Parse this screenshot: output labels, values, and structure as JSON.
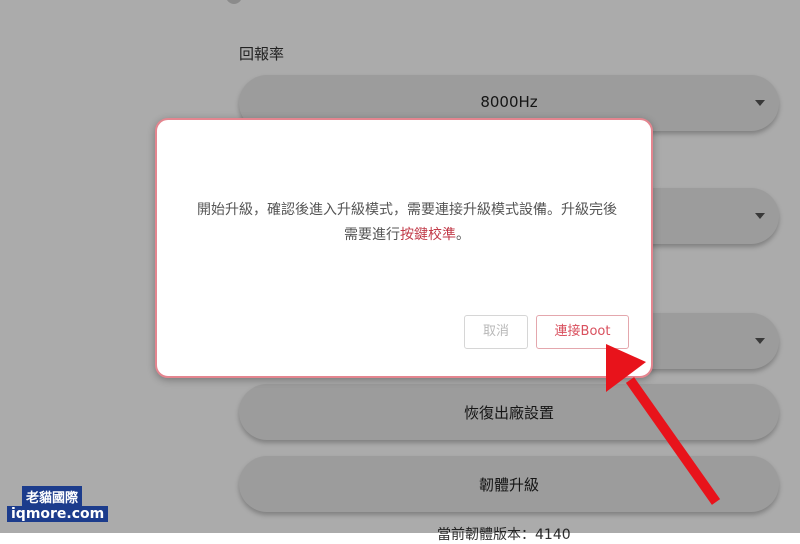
{
  "settings": {
    "report_rate_label": "回報率",
    "report_rate_value": "8000Hz",
    "restore_factory_label": "恢復出廠設置",
    "firmware_upgrade_label": "韌體升級",
    "firmware_version_text": "當前韌體版本：4140"
  },
  "dialog": {
    "message_part1": "開始升級，確認後進入升級模式，需要連接升級模式設備。升級完後需要進行",
    "message_highlight": "按鍵校準",
    "message_end": "。",
    "cancel_label": "取消",
    "connect_boot_label": "連接Boot"
  },
  "watermark": {
    "line1": "老貓國際",
    "line2": "iqmore.com"
  },
  "colors": {
    "dialog_border": "#e4858f",
    "highlight": "#c13a48",
    "arrow": "#e8131b",
    "watermark_bg": "#1c3c8c"
  }
}
